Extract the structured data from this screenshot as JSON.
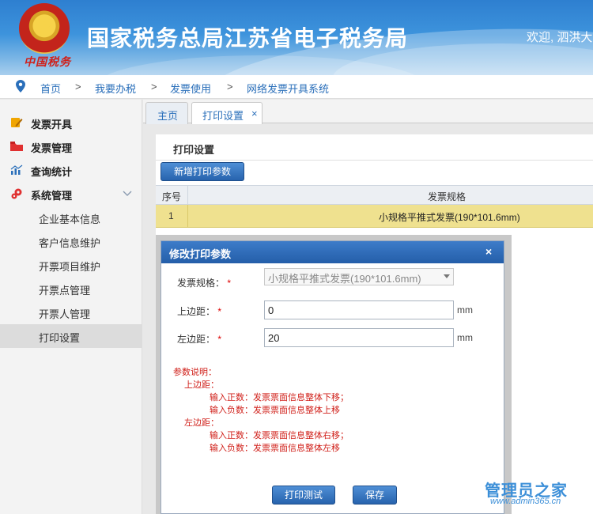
{
  "header": {
    "title": "国家税务总局江苏省电子税务局",
    "welcome": "欢迎, 泗洪大",
    "logo_text": "中国税务"
  },
  "breadcrumb": [
    "首页",
    "我要办税",
    "发票使用",
    "网络发票开具系统"
  ],
  "breadcrumb_sep": ">",
  "sidebar": {
    "items": [
      {
        "label": "发票开具",
        "icon": "pencil-note-icon",
        "color": "#f0a500"
      },
      {
        "label": "发票管理",
        "icon": "folder-icon",
        "color": "#e03030"
      },
      {
        "label": "查询统计",
        "icon": "chart-icon",
        "color": "#2a6fba"
      },
      {
        "label": "系统管理",
        "icon": "gears-icon",
        "color": "#e03030"
      }
    ],
    "sub_items": [
      "企业基本信息",
      "客户信息维护",
      "开票项目维护",
      "开票点管理",
      "开票人管理",
      "打印设置"
    ]
  },
  "tabs": [
    {
      "label": "主页"
    },
    {
      "label": "打印设置",
      "close": "×"
    }
  ],
  "main": {
    "title": "打印设置",
    "add_button": "新增打印参数",
    "columns": [
      "序号",
      "发票规格"
    ],
    "rows": [
      {
        "index": "1",
        "spec": "小规格平推式发票(190*101.6mm)"
      }
    ]
  },
  "dialog": {
    "title": "修改打印参数",
    "close": "×",
    "spec_label": "发票规格：",
    "spec_value": "小规格平推式发票(190*101.6mm)",
    "top_label": "上边距：",
    "top_value": "0",
    "left_label": "左边距：",
    "left_value": "20",
    "required_mark": "*",
    "unit": "mm",
    "notes": [
      "参数说明：",
      "上边距：",
      "输入正数：发票票面信息整体下移；",
      "输入负数：发票票面信息整体上移",
      "左边距：",
      "输入正数：发票票面信息整体右移；",
      "输入负数：发票票面信息整体左移"
    ],
    "print_test_button": "打印测试",
    "save_button": "保存"
  },
  "watermark": {
    "line1": "管理员之家",
    "line2": "www.admin365.cn"
  }
}
